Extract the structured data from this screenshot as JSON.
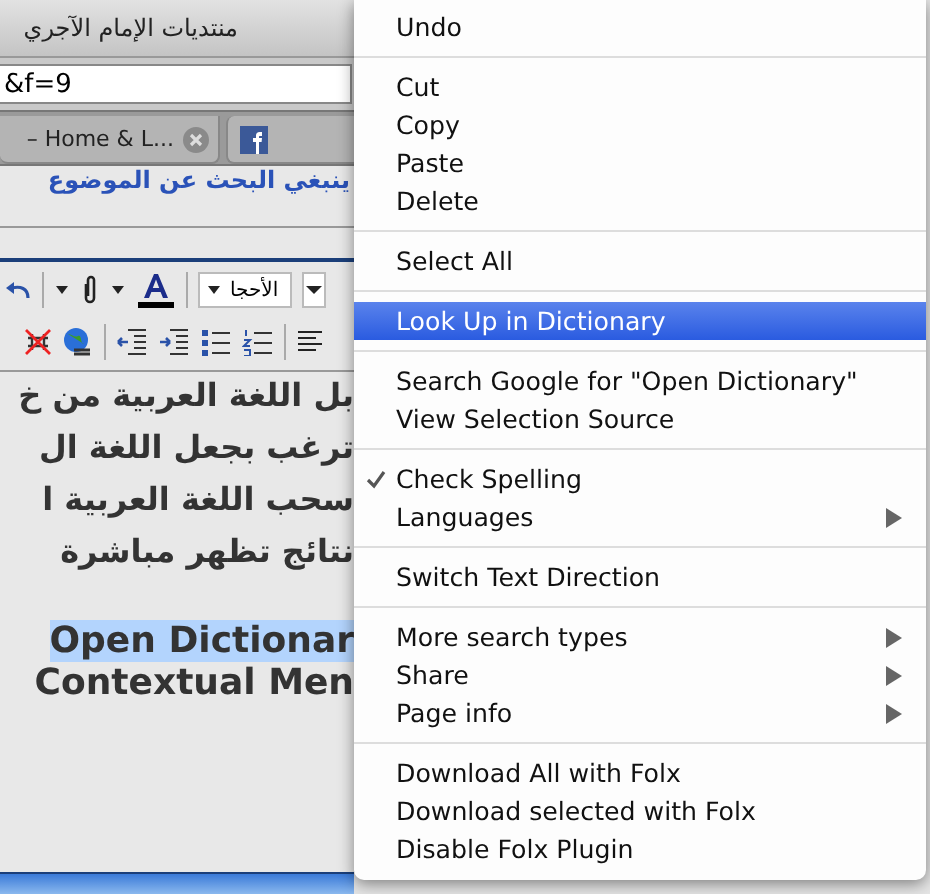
{
  "window": {
    "title": "منتديات الإمام الآجري"
  },
  "address_bar": {
    "value": "&f=9"
  },
  "tabs": [
    {
      "label": "– Home & L...",
      "selected": false,
      "kind": "text"
    },
    {
      "kind": "facebook",
      "selected": false
    }
  ],
  "page_link": "ينبغي البحث عن الموضوع",
  "editor": {
    "font": "الأحجا",
    "lines": [
      "بل اللغة العربية من خ",
      "ترغب بجعل اللغة ال",
      "سحب اللغة العربية ا",
      "نتائج تظهر مباشرة"
    ],
    "selected_text": "Open Dictionar",
    "next_line": "Contextual Men"
  },
  "context_menu": {
    "groups": [
      [
        {
          "label": "Undo",
          "selected": false,
          "checked": false,
          "submenu": false
        }
      ],
      [
        {
          "label": "Cut",
          "selected": false,
          "checked": false,
          "submenu": false
        },
        {
          "label": "Copy",
          "selected": false,
          "checked": false,
          "submenu": false
        },
        {
          "label": "Paste",
          "selected": false,
          "checked": false,
          "submenu": false
        },
        {
          "label": "Delete",
          "selected": false,
          "checked": false,
          "submenu": false
        }
      ],
      [
        {
          "label": "Select All",
          "selected": false,
          "checked": false,
          "submenu": false
        }
      ],
      [
        {
          "label": "Look Up in Dictionary",
          "selected": true,
          "checked": false,
          "submenu": false
        }
      ],
      [
        {
          "label": "Search Google for \"Open Dictionary\"",
          "selected": false,
          "checked": false,
          "submenu": false
        },
        {
          "label": "View Selection Source",
          "selected": false,
          "checked": false,
          "submenu": false
        }
      ],
      [
        {
          "label": "Check Spelling",
          "selected": false,
          "checked": true,
          "submenu": false
        },
        {
          "label": "Languages",
          "selected": false,
          "checked": false,
          "submenu": true
        }
      ],
      [
        {
          "label": "Switch Text Direction",
          "selected": false,
          "checked": false,
          "submenu": false
        }
      ],
      [
        {
          "label": "More search types",
          "selected": false,
          "checked": false,
          "submenu": true
        },
        {
          "label": "Share",
          "selected": false,
          "checked": false,
          "submenu": true
        },
        {
          "label": "Page info",
          "selected": false,
          "checked": false,
          "submenu": true
        }
      ],
      [
        {
          "label": "Download All with Folx",
          "selected": false,
          "checked": false,
          "submenu": false
        },
        {
          "label": "Download selected with Folx",
          "selected": false,
          "checked": false,
          "submenu": false
        },
        {
          "label": "Disable Folx Plugin",
          "selected": false,
          "checked": false,
          "submenu": false
        }
      ]
    ]
  }
}
